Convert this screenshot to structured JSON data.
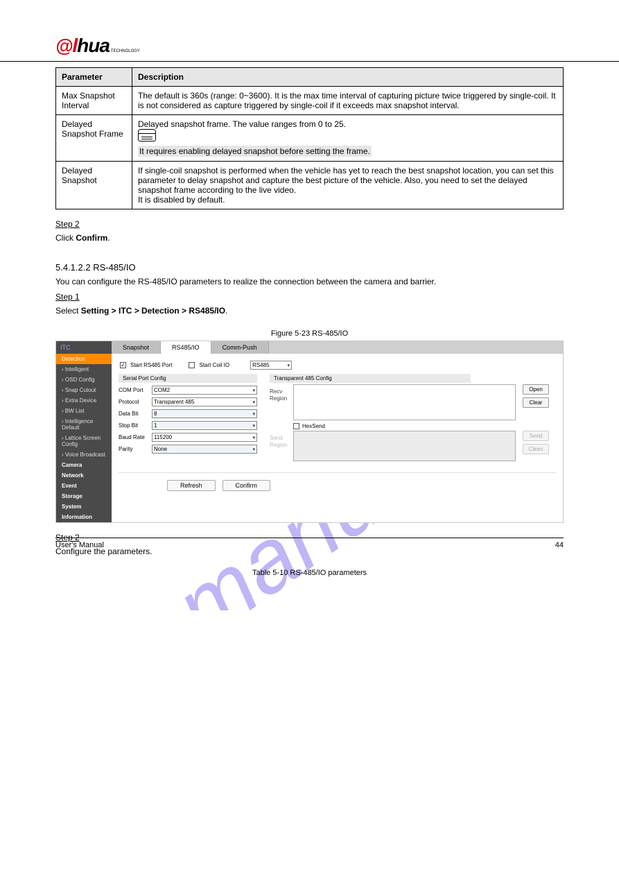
{
  "header": {
    "logo_tech": "TECHNOLOGY"
  },
  "table1": {
    "h1": "Parameter",
    "h2": "Description",
    "rows": [
      {
        "p": "Max Snapshot Interval",
        "d": "The default is 360s (range: 0~3600). It is the max time interval of capturing picture twice triggered by single-coil. It is not considered as capture triggered by single-coil if it exceeds max snapshot interval."
      },
      {
        "p": "Delayed Snapshot Frame",
        "d1": "Delayed snapshot frame. The value ranges from 0 to 25.",
        "d2_hl": "It requires enabling delayed snapshot before setting the frame."
      },
      {
        "p": "Delayed Snapshot",
        "d": "If single-coil snapshot is performed when the vehicle has yet to reach the best snapshot location, you can set this parameter to delay snapshot and capture the best picture of the vehicle. Also, you need to set the delayed snapshot frame according to the live video.\nIt is disabled by default."
      }
    ]
  },
  "step2_title": "Step 2",
  "step2_body1": "Click ",
  "step2_body_confirm": "Confirm",
  "step2_body2": ".",
  "sec_title": "5.4.1.2.2 RS-485/IO",
  "sec_body1": "You can configure the RS-485/IO parameters to realize the connection between the camera and barrier.",
  "step1_title": "Step 1",
  "step1_body": "Select Setting > ITC > Detection > RS485/IO.",
  "fig_caption": "Figure 5-23 RS-485/IO",
  "ui": {
    "brand": "ITC",
    "side_active": "Detection",
    "side_items": [
      "Intelligent",
      "OSD Config",
      "Snap Cutout",
      "Extra Device",
      "BW List",
      "Intelligence Default",
      "Lattice Screen Config",
      "Voice Broadcast"
    ],
    "side_groups": [
      "Camera",
      "Network",
      "Event",
      "Storage",
      "System",
      "Information"
    ],
    "tabs": {
      "t1": "Snapshot",
      "t2": "RS485/IO",
      "t3": "Comm-Push"
    },
    "chk1": "Start RS485 Port",
    "chk2": "Start Coil IO",
    "type_sel": "RS485",
    "left_panel": "Serial Port Config",
    "right_panel": "Transparent 485 Config",
    "form": {
      "com_lbl": "COM Port",
      "com_val": "COM2",
      "proto_lbl": "Protocol",
      "proto_val": "Transparent 485",
      "data_lbl": "Data Bit",
      "data_val": "8",
      "stop_lbl": "Stop Bit",
      "stop_val": "1",
      "baud_lbl": "Baud Rate",
      "baud_val": "115200",
      "parity_lbl": "Parity",
      "parity_val": "None"
    },
    "recv_lbl": "Recv\nRegion",
    "send_lbl": "Send\nRegion",
    "hex": "HexSend",
    "btns": {
      "open": "Open",
      "clear": "Clear",
      "send": "Send",
      "clean": "Clean",
      "refresh": "Refresh",
      "confirm": "Confirm"
    }
  },
  "step2b_title": "Step 2",
  "step2b_body": "Configure the parameters.",
  "tbl2_caption": "Table 5-10 RS-485/IO parameters",
  "footer": {
    "left": "User's Manual",
    "right": "44"
  }
}
